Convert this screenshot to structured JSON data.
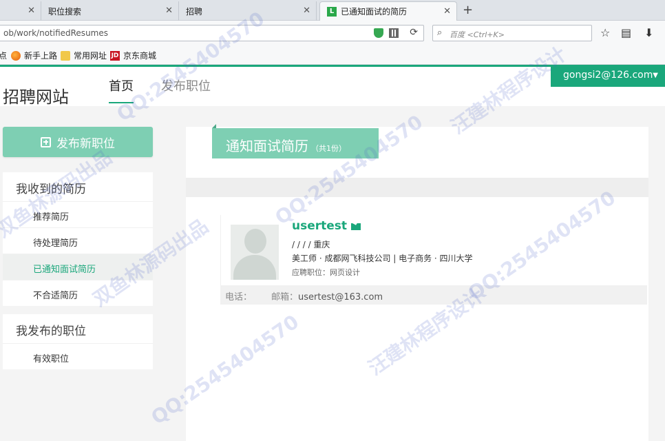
{
  "browser": {
    "tabs": [
      {
        "label": ""
      },
      {
        "label": "职位搜索"
      },
      {
        "label": "招聘"
      },
      {
        "label": "已通知面试的简历",
        "favicon": "L"
      }
    ],
    "new_tab": "+",
    "url": "ob/work/notifiedResumes",
    "search_placeholder": "百度 <Ctrl+K>",
    "bookmarks": [
      {
        "label": "点",
        "icon": ""
      },
      {
        "label": "新手上路",
        "icon": "firefox-icon"
      },
      {
        "label": "常用网址",
        "icon": "folder-icon"
      },
      {
        "label": "京东商城",
        "icon": "jd-icon",
        "icon_text": "JD"
      }
    ]
  },
  "site": {
    "logo": "招聘网站",
    "nav": [
      {
        "label": "首页"
      },
      {
        "label": "发布职位"
      }
    ],
    "user": "gongsi2@126.com",
    "accent": "#1aa77b"
  },
  "sidebar": {
    "post_button": "发布新职位",
    "groups": [
      {
        "title": "我收到的简历",
        "items": [
          {
            "label": "推荐简历"
          },
          {
            "label": "待处理简历"
          },
          {
            "label": "已通知面试简历"
          },
          {
            "label": "不合适简历"
          }
        ]
      },
      {
        "title": "我发布的职位",
        "items": [
          {
            "label": "有效职位"
          }
        ]
      }
    ]
  },
  "main": {
    "title": "通知面试简历",
    "count": "（共1份）",
    "resume": {
      "name": "usertest",
      "line1": "/ / / / 重庆",
      "line2": "美工师 · 成都网飞科技公司 | 电子商务 · 四川大学",
      "applied": "应聘职位：网页设计",
      "phone_label": "电话：",
      "email_label": "邮箱：",
      "email": "usertest@163.com"
    }
  },
  "watermark": {
    "qq": "QQ:2545404570",
    "a": "汪建林程序设计",
    "b": "双鱼林源码出品"
  }
}
